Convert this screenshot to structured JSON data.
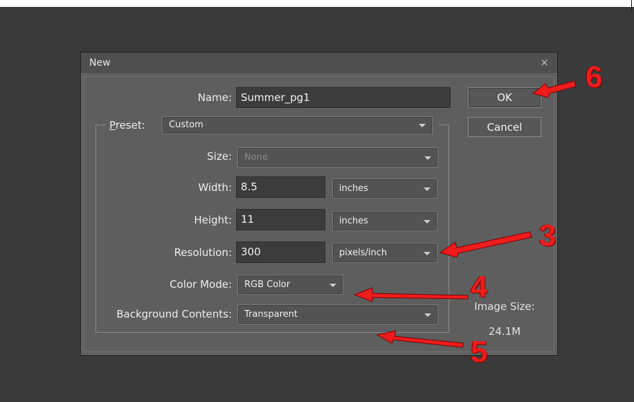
{
  "dialog": {
    "title": "New",
    "close_glyph": "×"
  },
  "fields": {
    "name": {
      "label": "Name:",
      "value": "Summer_pg1"
    },
    "preset": {
      "label_prefix": "P",
      "label_rest": "reset:",
      "value": "Custom"
    },
    "size": {
      "label": "Size:",
      "value": "None"
    },
    "width": {
      "label": "Width:",
      "value": "8.5",
      "unit": "inches"
    },
    "height": {
      "label": "Height:",
      "value": "11",
      "unit": "inches"
    },
    "resolution": {
      "label": "Resolution:",
      "value": "300",
      "unit": "pixels/inch"
    },
    "color_mode": {
      "label": "Color Mode:",
      "value": "RGB Color"
    },
    "background": {
      "label": "Background Contents:",
      "value": "Transparent"
    }
  },
  "buttons": {
    "ok": "OK",
    "cancel": "Cancel"
  },
  "image_size": {
    "label": "Image Size:",
    "value": "24.1M"
  },
  "annotations": {
    "n3": "3",
    "n4": "4",
    "n5": "5",
    "n6": "6",
    "arrow_color": "#ee1c1c"
  },
  "colors": {
    "background": "#3a3a3a",
    "dialog": "#5e5e5e",
    "titlebar": "#4f4f4f",
    "field": "#3c3c3c"
  }
}
